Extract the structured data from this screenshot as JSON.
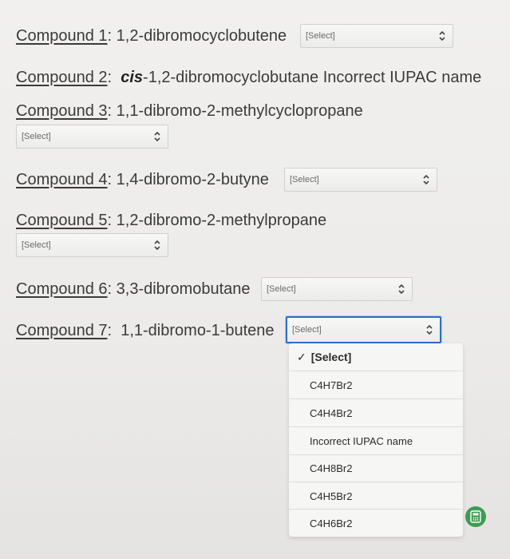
{
  "compounds": [
    {
      "label": "Compound 1",
      "sep": ":",
      "name": "1,2-dibromocyclobutene",
      "select": "[Select]"
    },
    {
      "label": "Compound 2",
      "sep": ":",
      "prefix": "cis",
      "name": "-1,2-dibromocyclobutane",
      "answer": "Incorrect IUPAC name"
    },
    {
      "label": "Compound 3",
      "sep": ":",
      "name": "1,1-dibromo-2-methylcyclopropane",
      "select": "[Select]"
    },
    {
      "label": "Compound 4",
      "sep": ":",
      "name": "1,4-dibromo-2-butyne",
      "select": "[Select]"
    },
    {
      "label": "Compound 5",
      "sep": ":",
      "name": "1,2-dibromo-2-methylpropane",
      "select": "[Select]"
    },
    {
      "label": "Compound 6",
      "sep": ":",
      "name": "3,3-dibromobutane",
      "select": "[Select]"
    },
    {
      "label": "Compound 7",
      "sep": ":",
      "name": "1,1-dibromo-1-butene",
      "select": "[Select]"
    }
  ],
  "dropdown": {
    "selected": "[Select]",
    "check": "✓",
    "options": [
      "C4H7Br2",
      "C4H4Br2",
      "Incorrect IUPAC name",
      "C4H8Br2",
      "C4H5Br2",
      "C4H6Br2"
    ]
  },
  "colors": {
    "focus": "#2f6ec8",
    "fab": "#3f9b52"
  },
  "icons": {
    "select_arrow": "chevron-up-down-icon",
    "fab": "calculator-icon"
  }
}
